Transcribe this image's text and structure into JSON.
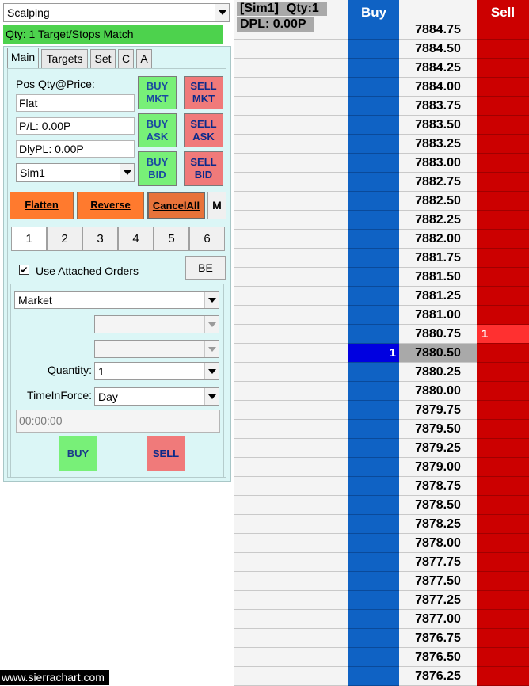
{
  "top": {
    "mode_select": "Scalping",
    "status": "Qty: 1 Target/Stops Match"
  },
  "tabs": [
    "Main",
    "Targets",
    "Set",
    "C",
    "A"
  ],
  "position": {
    "label": "Pos Qty@Price:",
    "qty_price": "Flat",
    "pl": "P/L: 0.00P",
    "daily_pl": "DlyPL: 0.00P",
    "account": "Sim1"
  },
  "order_buttons": {
    "buy_mkt": [
      "BUY",
      "MKT"
    ],
    "sell_mkt": [
      "SELL",
      "MKT"
    ],
    "buy_ask": [
      "BUY",
      "ASK"
    ],
    "sell_ask": [
      "SELL",
      "ASK"
    ],
    "buy_bid": [
      "BUY",
      "BID"
    ],
    "sell_bid": [
      "SELL",
      "BID"
    ]
  },
  "actions": {
    "flatten": "Flatten",
    "reverse": "Reverse",
    "cancel_all": "CancelAll",
    "m": "M"
  },
  "qty_presets": [
    "1",
    "2",
    "3",
    "4",
    "5",
    "6"
  ],
  "attached": {
    "checkbox_label": "Use Attached Orders",
    "checked": true,
    "be": "BE"
  },
  "order_entry": {
    "order_type": "Market",
    "quantity_label": "Quantity:",
    "quantity": "1",
    "tif_label": "TimeInForce:",
    "tif": "Day",
    "time": "00:00:00",
    "buy": "BUY",
    "sell": "SELL"
  },
  "dom": {
    "account": "[Sim1]",
    "qty": "Qty:1",
    "dpl": "DPL: 0.00P",
    "buy_header": "Buy",
    "sell_header": "Sell",
    "prices": [
      "7884.75",
      "7884.50",
      "7884.25",
      "7884.00",
      "7883.75",
      "7883.50",
      "7883.25",
      "7883.00",
      "7882.75",
      "7882.50",
      "7882.25",
      "7882.00",
      "7881.75",
      "7881.50",
      "7881.25",
      "7881.00",
      "7880.75",
      "7880.50",
      "7880.25",
      "7880.00",
      "7879.75",
      "7879.50",
      "7879.25",
      "7879.00",
      "7878.75",
      "7878.50",
      "7878.25",
      "7878.00",
      "7877.75",
      "7877.50",
      "7877.25",
      "7877.00",
      "7876.75",
      "7876.50",
      "7876.25"
    ],
    "ask_price": "7880.75",
    "ask_size": "1",
    "bid_price": "7880.50",
    "bid_size": "1",
    "colors": {
      "buy_column": "#0f62c4",
      "sell_column": "#cc0000",
      "best_bid": "#0000e0",
      "best_ask": "#ff3030",
      "last_price": "#a9a9a9"
    }
  },
  "footer": {
    "watermark": "www.sierrachart.com"
  }
}
